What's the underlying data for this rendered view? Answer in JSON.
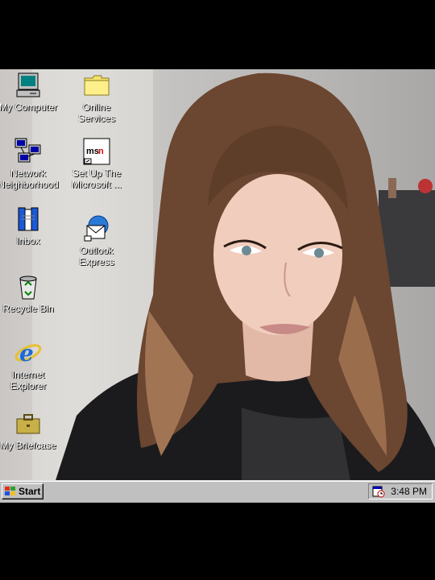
{
  "desktop": {
    "icons": [
      {
        "label": "My Computer",
        "icon": "my-computer-icon"
      },
      {
        "label": "Online\nServices",
        "icon": "folder-icon"
      },
      {
        "label": "Network\nNeighborhood",
        "icon": "network-neighborhood-icon"
      },
      {
        "label": "Set Up The\nMicrosoft ...",
        "icon": "msn-icon"
      },
      {
        "label": "Inbox",
        "icon": "inbox-icon"
      },
      {
        "label": "Outlook\nExpress",
        "icon": "outlook-express-icon"
      },
      {
        "label": "Recycle Bin",
        "icon": "recycle-bin-icon"
      },
      {
        "label": "Internet\nExplorer",
        "icon": "internet-explorer-icon"
      },
      {
        "label": "My Briefcase",
        "icon": "briefcase-icon"
      }
    ],
    "wallpaper": "photo"
  },
  "taskbar": {
    "start_label": "Start",
    "clock": "3:48 PM",
    "tray_icon": "scheduler-icon",
    "color": "#c0c0c0"
  }
}
